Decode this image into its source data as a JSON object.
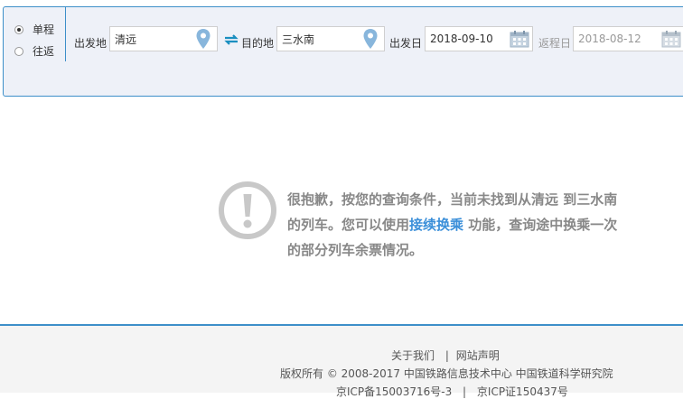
{
  "search": {
    "trip_types": [
      {
        "label": "单程",
        "checked": true
      },
      {
        "label": "往返",
        "checked": false
      }
    ],
    "from_label": "出发地",
    "from_value": "清远",
    "to_label": "目的地",
    "to_value": "三水南",
    "depart_label": "出发日",
    "depart_value": "2018-09-10",
    "return_label": "返程日",
    "return_value": "2018-08-12"
  },
  "notice": {
    "line1": "很抱歉，按您的查询条件，当前未找到从清远 到三水南",
    "line2_prefix": "的列车。您可以使用",
    "link_text": "接续换乘",
    "line2_suffix": " 功能，查询途中换乘一次",
    "line3": "的部分列车余票情况。"
  },
  "footer": {
    "about": "关于我们",
    "separator": "|",
    "statement": "网站声明",
    "copyright": "版权所有 © 2008-2017 中国铁路信息技术中心 中国铁道科学研究院",
    "icp1": "京ICP备15003716号-3",
    "icp_separator": "|",
    "icp2": "京ICP证150437号"
  },
  "colors": {
    "accent": "#3d8fc9",
    "link": "#3b8fd9",
    "notice_text": "#888888",
    "icon_blue": "#88b6dc"
  },
  "icons": {
    "location": "map-pin-icon",
    "calendar": "calendar-icon",
    "swap": "swap-arrows-icon",
    "notice": "exclamation-circle-icon"
  }
}
